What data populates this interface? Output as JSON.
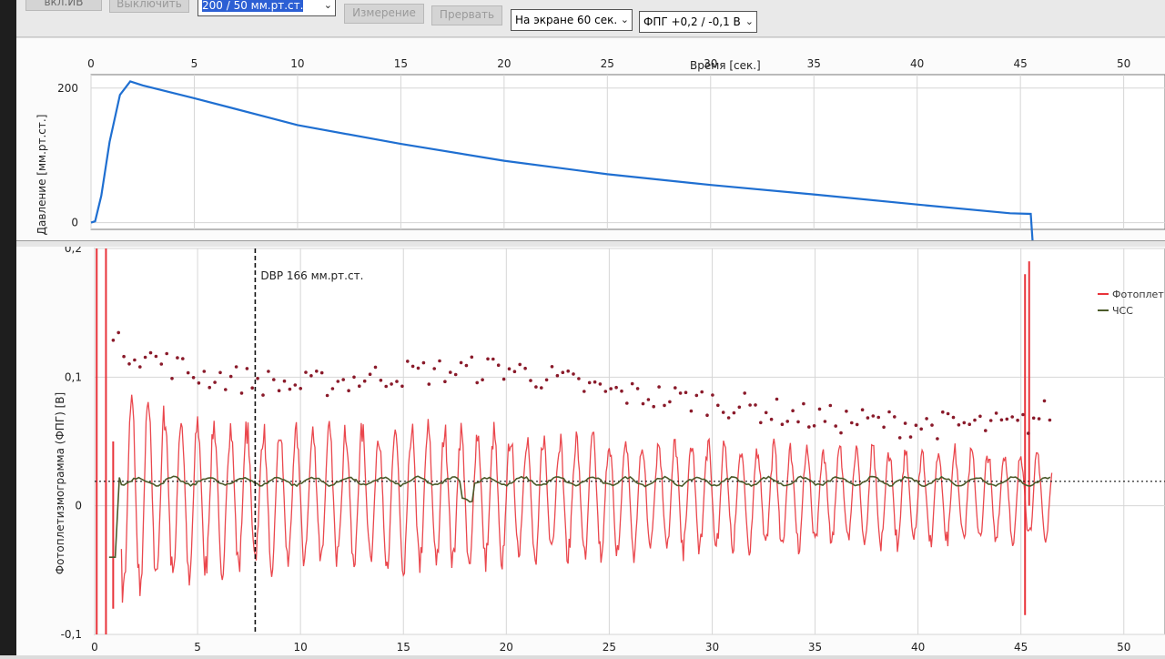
{
  "toolbar": {
    "cut_button": "вкл.ИВ",
    "off_button": "Выключить",
    "range_select": "200 / 50  мм.рт.ст.",
    "measure_button": "Измерение",
    "abort_button": "Прервать",
    "screen_select": "На экране 60 сек.",
    "ppg_select": "ФПГ +0,2 / -0,1  В"
  },
  "chart_data": [
    {
      "type": "line",
      "title": "",
      "xlabel": "Время [сек.]",
      "ylabel": "Давление [мм.рт.ст.]",
      "xlim": [
        0,
        52
      ],
      "ylim": [
        -10,
        220
      ],
      "x_ticks": [
        "0",
        "5",
        "10",
        "15",
        "20",
        "25",
        "30",
        "35",
        "40",
        "45",
        "50"
      ],
      "y_ticks": [
        "200",
        "0"
      ],
      "grid": true,
      "series": [
        {
          "color": "#1f6fd1",
          "x": [
            0,
            0.2,
            0.5,
            0.9,
            1.4,
            1.9,
            2.5,
            5,
            10,
            15,
            20,
            25,
            30,
            35,
            40,
            44.5,
            45.5,
            45.6,
            46.3
          ],
          "y": [
            0,
            2,
            40,
            120,
            190,
            210,
            204,
            185,
            145,
            117,
            92,
            72,
            56,
            42,
            27,
            14,
            13,
            -33,
            -33
          ]
        }
      ]
    },
    {
      "type": "line",
      "xlabel": "",
      "ylabel": "Фотоплетизмограмма (ФПГ) [В]",
      "xlim": [
        0,
        52
      ],
      "ylim": [
        -0.1,
        0.2
      ],
      "x_ticks": [
        "0",
        "5",
        "10",
        "15",
        "20",
        "25",
        "30",
        "35",
        "40",
        "45",
        "50"
      ],
      "y_ticks": [
        "0,2",
        "0,1",
        "0",
        "-0,1"
      ],
      "grid": true,
      "annotation": "DBP  166 мм.рт.ст.",
      "annotation_x": 7.8,
      "series": [
        {
          "name": "Фотоплет",
          "color": "#e8333a"
        },
        {
          "name": "ЧСС",
          "color": "#4b5a2a"
        }
      ],
      "dots_color": "#8a1a2a",
      "dot_envelope_x": [
        1,
        5,
        10,
        15,
        20,
        25,
        30,
        35,
        40,
        45,
        46.5
      ],
      "dot_envelope_y": [
        0.125,
        0.102,
        0.093,
        0.103,
        0.107,
        0.088,
        0.081,
        0.068,
        0.063,
        0.062,
        0.075
      ],
      "ppg_amplitude_x": [
        1.5,
        5,
        10,
        15,
        20,
        25,
        30,
        35,
        40,
        45
      ],
      "ppg_amplitude_y": [
        0.085,
        0.065,
        0.055,
        0.06,
        0.055,
        0.05,
        0.045,
        0.042,
        0.04,
        0.038
      ],
      "hr_level": 0.019
    }
  ]
}
